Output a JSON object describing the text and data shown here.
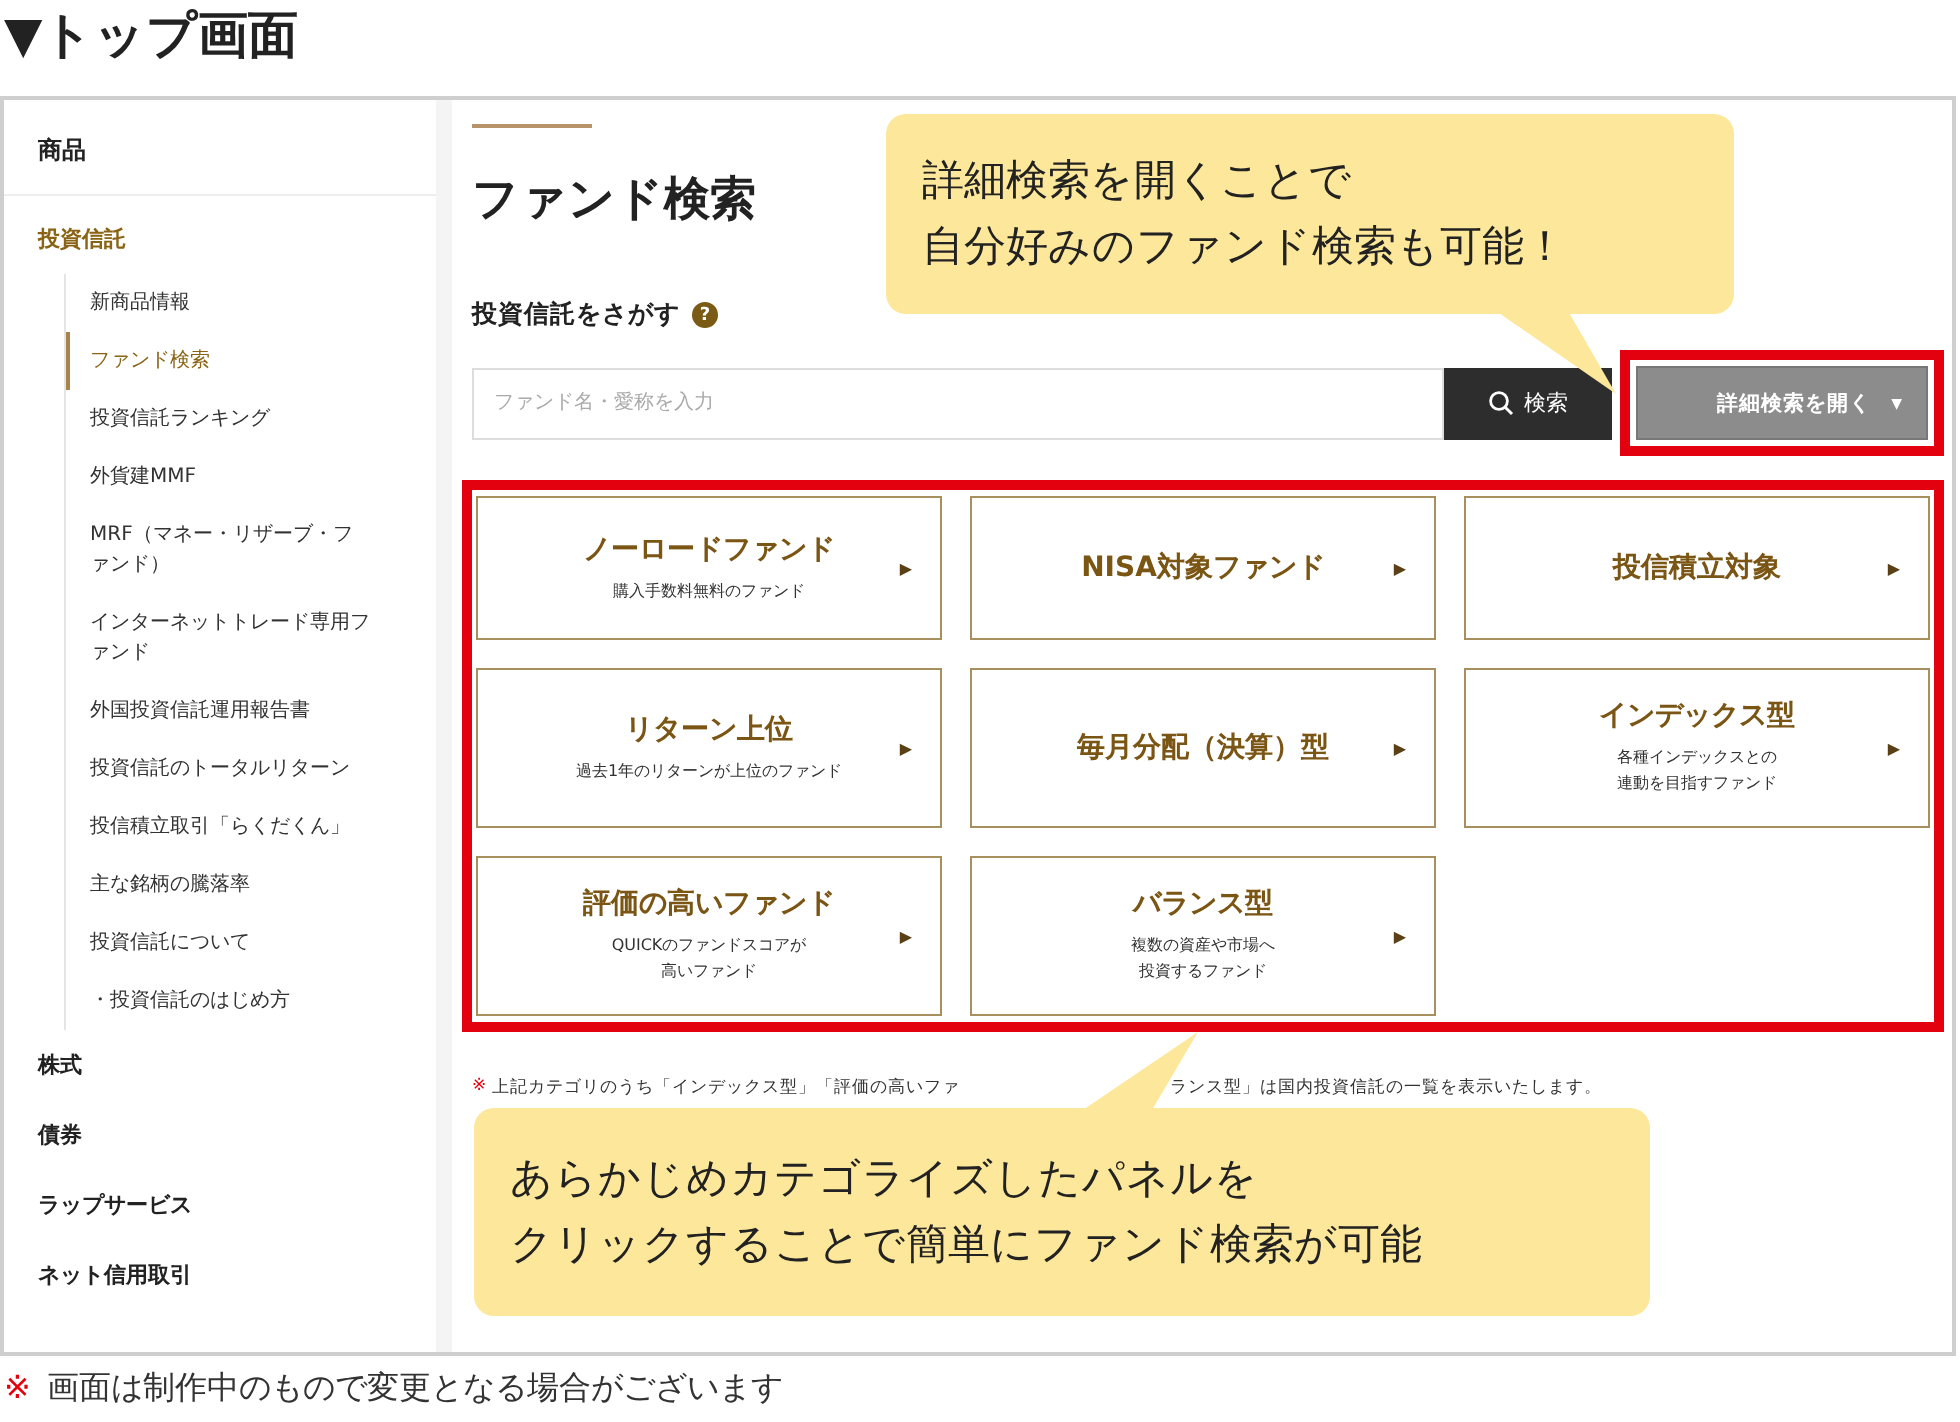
{
  "heading": "▼トップ画面",
  "sidebar": {
    "title": "商品",
    "sections": [
      {
        "label": "投資信託",
        "active": true,
        "children": [
          {
            "label": "新商品情報",
            "selected": false
          },
          {
            "label": "ファンド検索",
            "selected": true
          },
          {
            "label": "投資信託ランキング",
            "selected": false
          },
          {
            "label": "外貨建MMF",
            "selected": false
          },
          {
            "label": "MRF（マネー・リザーブ・ファンド）",
            "selected": false
          },
          {
            "label": "インターネットトレード専用ファンド",
            "selected": false
          },
          {
            "label": "外国投資信託運用報告書",
            "selected": false
          },
          {
            "label": "投資信託のトータルリターン",
            "selected": false
          },
          {
            "label": "投信積立取引「らくだくん」",
            "selected": false
          },
          {
            "label": "主な銘柄の騰落率",
            "selected": false
          },
          {
            "label": "投資信託について",
            "selected": false
          },
          {
            "label": "・投資信託のはじめ方",
            "selected": false
          }
        ]
      },
      {
        "label": "株式",
        "active": false
      },
      {
        "label": "債券",
        "active": false
      },
      {
        "label": "ラップサービス",
        "active": false
      },
      {
        "label": "ネット信用取引",
        "active": false
      }
    ]
  },
  "page_title": "ファンド検索",
  "search": {
    "label": "投資信託をさがす",
    "help": "?",
    "placeholder": "ファンド名・愛称を入力",
    "button": "検索",
    "detail_button": "詳細検索を開く",
    "detail_caret": "▼"
  },
  "panels": [
    {
      "title": "ノーロードファンド",
      "sub": [
        "購入手数料無料のファンド"
      ],
      "arrow": "▶"
    },
    {
      "title": "NISA対象ファンド",
      "arrow": "▶"
    },
    {
      "title": "投信積立対象",
      "arrow": "▶"
    },
    {
      "title": "リターン上位",
      "sub": [
        "過去1年のリターンが上位のファンド"
      ],
      "arrow": "▶"
    },
    {
      "title": "毎月分配（決算）型",
      "arrow": "▶"
    },
    {
      "title": "インデックス型",
      "sub": [
        "各種インデックスとの",
        "連動を目指すファンド"
      ],
      "arrow": "▶"
    },
    {
      "title": "評価の高いファンド",
      "sub": [
        "QUICKのファンドスコアが",
        "高いファンド"
      ],
      "arrow": "▶"
    },
    {
      "title": "バランス型",
      "sub": [
        "複数の資産や市場へ",
        "投資するファンド"
      ],
      "arrow": "▶"
    }
  ],
  "note": {
    "mark": "※",
    "parts": [
      "上記カテゴリのうち「インデックス型」「評価の高いファ",
      "ランス型」は国内投資信託の一覧を表示いたします。"
    ]
  },
  "callouts": [
    {
      "lines": [
        "詳細検索を開くことで",
        "自分好みのファンド検索も可能！"
      ]
    },
    {
      "lines": [
        "あらかじめカテゴライズしたパネルを",
        "クリックすることで簡単にファンド検索が可能"
      ]
    }
  ],
  "footer": {
    "mark": "※",
    "text": "画面は制作中のもので変更となる場合がございます"
  }
}
